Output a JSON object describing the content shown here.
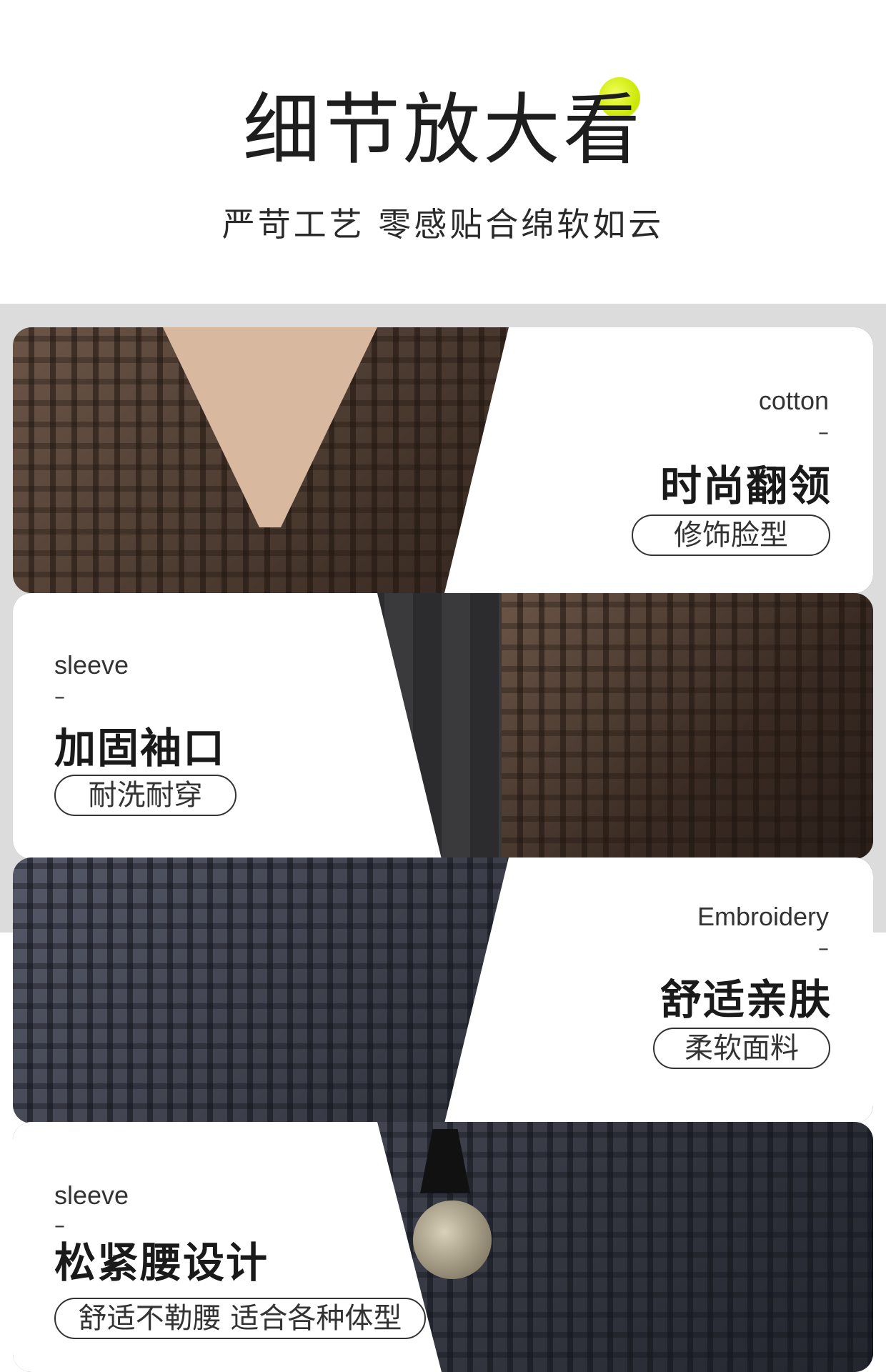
{
  "header": {
    "title": "细节放大看",
    "subtitle": "严苛工艺 零感贴合绵软如云"
  },
  "features": [
    {
      "en": "cotton",
      "dash": "–",
      "cn": "时尚翻领",
      "tag": "修饰脸型"
    },
    {
      "en": "sleeve",
      "dash": "–",
      "cn": "加固袖口",
      "tag": "耐洗耐穿"
    },
    {
      "en": "Embroidery",
      "dash": "–",
      "cn": "舒适亲肤",
      "tag": "柔软面料"
    },
    {
      "en": "sleeve",
      "dash": "–",
      "cn": "松紧腰设计",
      "tag": "舒适不勒腰 适合各种体型"
    }
  ],
  "colors": {
    "accent_dot": "#c8e600",
    "text": "#1a1a1a",
    "band": "#dcdcdc"
  }
}
